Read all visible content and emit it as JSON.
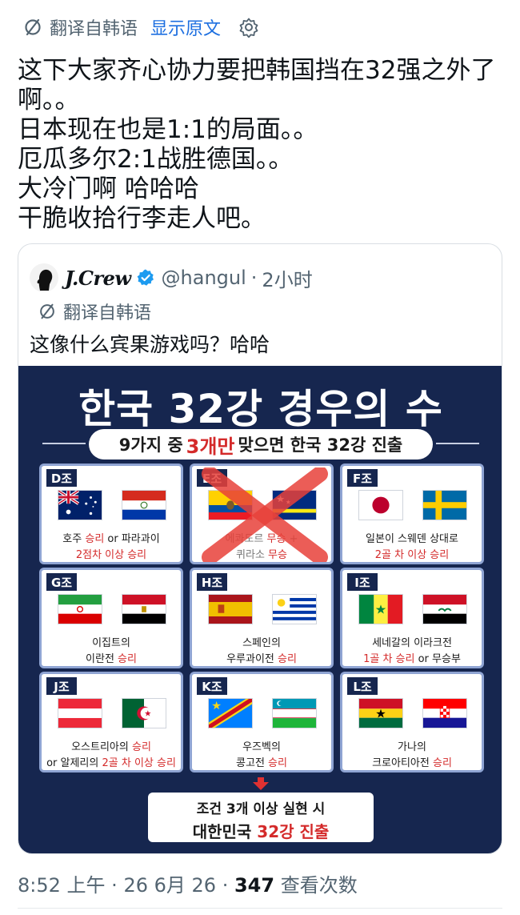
{
  "translation_bar": {
    "label": "翻译自韩语",
    "show_original": "显示原文"
  },
  "tweet": {
    "lines": [
      "这下大家齐心协力要把韩国挡在32强之外了",
      "啊。。",
      "日本现在也是1:1的局面。。",
      "厄瓜多尔2:1战胜德国。。",
      "大冷门啊 哈哈哈",
      "干脆收拾行李走人吧。"
    ]
  },
  "quote": {
    "name": "J.Crew",
    "handle": "@hangul",
    "time": "2小时",
    "translate_label": "翻译自韩语",
    "text": "这像什么宾果游戏吗？哈哈",
    "poster": {
      "title": "한국 32강 경우의 수",
      "subtitle_before": "9가지 중",
      "subtitle_highlight": "3개만",
      "subtitle_after": "맞으면 한국 32강 진출",
      "groups": [
        {
          "label": "D조",
          "line1a": "호주 ",
          "line1b": "승리",
          "line1c": " or 파라과이",
          "line2a": "",
          "line2b": "2점차 이상 승리",
          "line2c": "",
          "flags": [
            "australia",
            "paraguay"
          ],
          "crossed": false
        },
        {
          "label": "E조",
          "line1a": "에콰도르 ",
          "line1b": "무승",
          "line1c": " +",
          "line2a": "퀴라소 ",
          "line2b": "무승",
          "line2c": "",
          "flags": [
            "ecuador",
            "curacao"
          ],
          "crossed": true
        },
        {
          "label": "F조",
          "line1a": "일본이 스웨덴 상대로",
          "line1b": "",
          "line1c": "",
          "line2a": "",
          "line2b": "2골 차 이상 승리",
          "line2c": "",
          "flags": [
            "japan",
            "sweden"
          ],
          "crossed": false
        },
        {
          "label": "G조",
          "line1a": "이집트의",
          "line1b": "",
          "line1c": "",
          "line2a": "이란전 ",
          "line2b": "승리",
          "line2c": "",
          "flags": [
            "iran",
            "egypt"
          ],
          "crossed": false
        },
        {
          "label": "H조",
          "line1a": "스페인의",
          "line1b": "",
          "line1c": "",
          "line2a": "우루과이전 ",
          "line2b": "승리",
          "line2c": "",
          "flags": [
            "spain",
            "uruguay"
          ],
          "crossed": false
        },
        {
          "label": "I조",
          "line1a": "세네갈의 이라크전",
          "line1b": "",
          "line1c": "",
          "line2a": "",
          "line2b": "1골 차 승리",
          "line2c": " or 무승부",
          "flags": [
            "senegal",
            "iraq"
          ],
          "crossed": false
        },
        {
          "label": "J조",
          "line1a": "오스트리아의 ",
          "line1b": "승리",
          "line1c": "",
          "line2a": "or 알제리의 ",
          "line2b": "2골 차 이상 승리",
          "line2c": "",
          "flags": [
            "austria",
            "algeria"
          ],
          "crossed": false
        },
        {
          "label": "K조",
          "line1a": "우즈벡의",
          "line1b": "",
          "line1c": "",
          "line2a": "콩고전 ",
          "line2b": "승리",
          "line2c": "",
          "flags": [
            "drcongo",
            "uzbekistan"
          ],
          "crossed": false
        },
        {
          "label": "L조",
          "line1a": "가나의",
          "line1b": "",
          "line1c": "",
          "line2a": "크로아티아전 ",
          "line2b": "승리",
          "line2c": "",
          "flags": [
            "ghana",
            "croatia"
          ],
          "crossed": false
        }
      ],
      "result_line1": "조건 3개 이상 실현 시",
      "result_line2_before": "대한민국 ",
      "result_line2_highlight": "32강 진출"
    }
  },
  "meta": {
    "time": "8:52 上午",
    "date": "26 6月 26",
    "views_count": "347",
    "views_label": "查看次数"
  },
  "colors": {
    "link": "#1d6fe0",
    "poster_bg": "#16264f",
    "highlight_red": "#d42a2a",
    "cell_border": "#8fa4d3",
    "secondary_text": "#536471"
  }
}
